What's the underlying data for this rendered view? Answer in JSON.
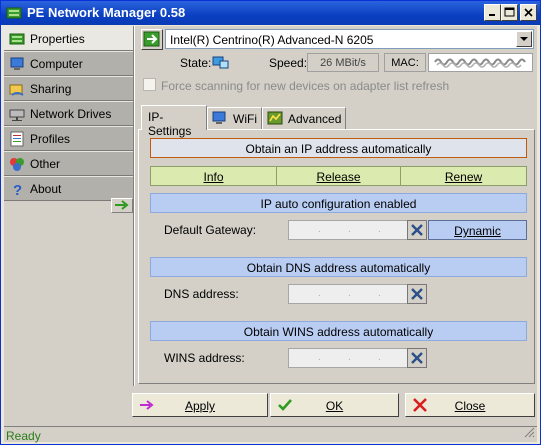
{
  "window": {
    "title": "PE Network Manager 0.58",
    "status": "Ready"
  },
  "sidebar": {
    "items": [
      {
        "label": "Properties",
        "icon": "properties-icon",
        "active": true
      },
      {
        "label": "Computer",
        "icon": "computer-icon",
        "active": false
      },
      {
        "label": "Sharing",
        "icon": "sharing-icon",
        "active": false
      },
      {
        "label": "Network Drives",
        "icon": "network-drives-icon",
        "active": false
      },
      {
        "label": "Profiles",
        "icon": "profiles-icon",
        "active": false
      },
      {
        "label": "Other",
        "icon": "other-icon",
        "active": false
      },
      {
        "label": "About",
        "icon": "about-icon",
        "active": false
      }
    ]
  },
  "adapter": {
    "selected": "Intel(R) Centrino(R) Advanced-N 6205",
    "state_label": "State:",
    "speed_label": "Speed:",
    "speed_value": "26 MBit/s",
    "mac_label": "MAC:",
    "force_scan_label": "Force scanning for new devices on adapter list refresh",
    "force_scan_checked": false
  },
  "tabs": [
    {
      "label": "IP-Settings",
      "active": true
    },
    {
      "label": "WiFi",
      "active": false
    },
    {
      "label": "Advanced",
      "active": false
    }
  ],
  "ip": {
    "obtain_ip": "Obtain an IP address automatically",
    "info": "Info",
    "release": "Release",
    "renew": "Renew",
    "auto_config": "IP auto configuration enabled",
    "gateway_label": "Default Gateway:",
    "dynamic": "Dynamic",
    "obtain_dns": "Obtain DNS address automatically",
    "dns_label": "DNS address:",
    "obtain_wins": "Obtain WINS address automatically",
    "wins_label": "WINS address:"
  },
  "buttons": {
    "apply": "Apply",
    "ok": "OK",
    "close": "Close"
  },
  "colors": {
    "accent_blue": "#b9cdf3",
    "accent_green": "#dbeaae",
    "accent_orange_border": "#c05a10",
    "status_green": "#2a7d1a"
  }
}
